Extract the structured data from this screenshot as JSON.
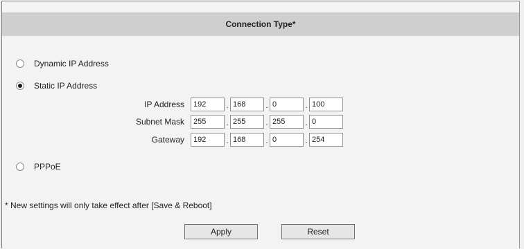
{
  "header": {
    "title": "Connection Type*"
  },
  "options": {
    "dynamic": {
      "label": "Dynamic IP Address",
      "selected": false
    },
    "static": {
      "label": "Static IP Address",
      "selected": true
    },
    "pppoe": {
      "label": "PPPoE",
      "selected": false
    }
  },
  "static_fields": {
    "ip": {
      "label": "IP Address",
      "octets": [
        "192",
        "168",
        "0",
        "100"
      ]
    },
    "subnet": {
      "label": "Subnet Mask",
      "octets": [
        "255",
        "255",
        "255",
        "0"
      ]
    },
    "gateway": {
      "label": "Gateway",
      "octets": [
        "192",
        "168",
        "0",
        "254"
      ]
    },
    "separator": "."
  },
  "note": "* New settings will only take effect after [Save & Reboot]",
  "buttons": {
    "apply": "Apply",
    "reset": "Reset"
  }
}
